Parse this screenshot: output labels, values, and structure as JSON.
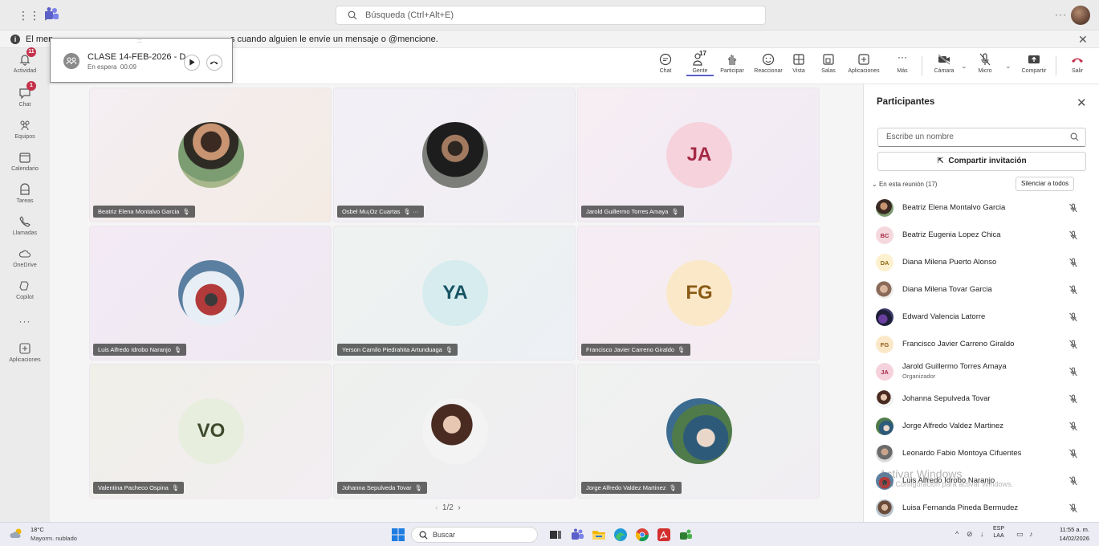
{
  "titlebar": {
    "search_placeholder": "Búsqueda (Ctrl+Alt+E)",
    "more": "···"
  },
  "banner": {
    "text_start": "El men",
    "text_end": "s cuando alguien le envíe un mensaje o @mencione.",
    "close": "✕"
  },
  "rail": {
    "items": [
      {
        "label": "Actividad",
        "icon": "bell-icon",
        "badge": "11"
      },
      {
        "label": "Chat",
        "icon": "chat-icon",
        "badge": "1"
      },
      {
        "label": "Equipos",
        "icon": "teams-icon"
      },
      {
        "label": "Calendario",
        "icon": "calendar-icon"
      },
      {
        "label": "Tareas",
        "icon": "tasks-icon"
      },
      {
        "label": "Llamadas",
        "icon": "phone-icon"
      },
      {
        "label": "OneDrive",
        "icon": "cloud-icon"
      },
      {
        "label": "Copilot",
        "icon": "copilot-icon"
      },
      {
        "label": "Aplicaciones",
        "icon": "add-apps-icon"
      }
    ],
    "more": "···"
  },
  "popup": {
    "title": "CLASE 14-FEB-2026 - D",
    "status": "En espera",
    "timer": "00:09",
    "grip": ":::"
  },
  "toolbar": {
    "chat": "Chat",
    "people": "Gente",
    "people_count": "17",
    "raise": "Participar",
    "react": "Reaccionar",
    "view": "Vista",
    "rooms": "Salas",
    "apps": "Aplicaciones",
    "more": "Más",
    "camera": "Cámara",
    "mic": "Micro",
    "share": "Compartir",
    "leave": "Salir",
    "accent_color": "#5b5fc7",
    "leave_color": "#c4314b"
  },
  "tiles": [
    {
      "name": "Beatriz Elena Montalvo Garcia",
      "kind": "photo"
    },
    {
      "name": "Osbel Mu¡Oz Cuartas",
      "kind": "photo",
      "extra": "···"
    },
    {
      "name": "Jarold Guillermo Torres Amaya",
      "kind": "initials",
      "initials": "JA"
    },
    {
      "name": "Luis Alfredo Idrobo Naranjo",
      "kind": "photo"
    },
    {
      "name": "Yerson Camilo Piedrahita Artunduaga",
      "kind": "initials",
      "initials": "YA"
    },
    {
      "name": "Francisco Javier Carreno Giraldo",
      "kind": "initials",
      "initials": "FG"
    },
    {
      "name": "Valentina Pacheco Ospina",
      "kind": "initials",
      "initials": "VO"
    },
    {
      "name": "Johanna Sepulveda Tovar",
      "kind": "photo"
    },
    {
      "name": "Jorge Alfredo Valdez Martinez",
      "kind": "photo"
    }
  ],
  "pager": "1/2",
  "panel": {
    "title": "Participantes",
    "search_placeholder": "Escribe un nombre",
    "invite": "Compartir invitación",
    "section": "En esta reunión (17)",
    "mute_all": "Silenciar a todos",
    "participants": [
      {
        "name": "Beatriz Elena Montalvo Garcia",
        "initials": ""
      },
      {
        "name": "Beatriz Eugenia Lopez Chica",
        "initials": "BC"
      },
      {
        "name": "Diana Milena Puerto Alonso",
        "initials": "DA"
      },
      {
        "name": "Diana Milena Tovar Garcia",
        "initials": ""
      },
      {
        "name": "Edward Valencia Latorre",
        "initials": ""
      },
      {
        "name": "Francisco Javier Carreno Giraldo",
        "initials": "FG"
      },
      {
        "name": "Jarold Guillermo Torres Amaya",
        "initials": "JA",
        "role": "Organizador"
      },
      {
        "name": "Johanna Sepulveda Tovar",
        "initials": ""
      },
      {
        "name": "Jorge Alfredo Valdez Martinez",
        "initials": ""
      },
      {
        "name": "Leonardo Fabio Montoya Cifuentes",
        "initials": ""
      },
      {
        "name": "Luis Alfredo Idrobo Naranjo",
        "initials": ""
      },
      {
        "name": "Luisa Fernanda Pineda Bermudez",
        "initials": ""
      }
    ]
  },
  "watermark": {
    "line1": "Activar Windows",
    "line2": "Ve a Configuración para activar Windows."
  },
  "taskbar": {
    "temp": "18°C",
    "weather": "Mayorm. nublado",
    "search": "Buscar",
    "lang_top": "ESP",
    "lang_bottom": "LAA",
    "time": "11:55 a. m.",
    "date": "14/02/2026"
  }
}
